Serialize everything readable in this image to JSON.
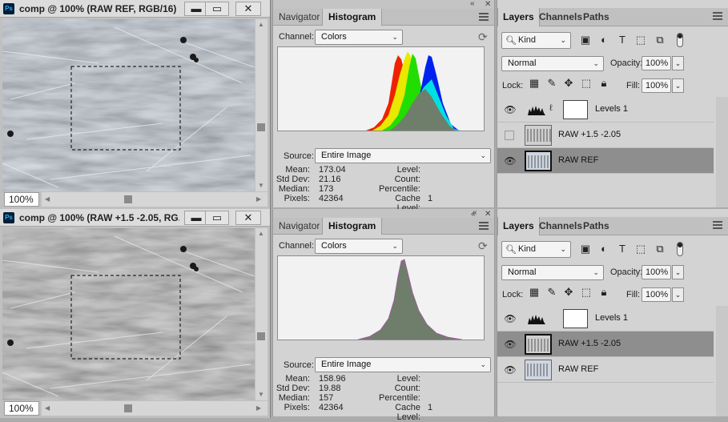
{
  "docs": [
    {
      "title": "comp @ 100% (RAW REF, RGB/16) *",
      "zoom": "100%",
      "minimize_label": "▬",
      "restore_label": "▭",
      "close_label": "✕"
    },
    {
      "title": "comp @ 100% (RAW +1.5 -2.05, RG...",
      "zoom": "100%",
      "minimize_label": "▬",
      "restore_label": "▭",
      "close_label": "✕"
    }
  ],
  "histograms": [
    {
      "tabs": [
        "Navigator",
        "Histogram"
      ],
      "channel_label": "Channel:",
      "channel_value": "Colors",
      "source_label": "Source:",
      "source_value": "Entire Image",
      "stats_left": [
        {
          "label": "Mean:",
          "value": "173.04"
        },
        {
          "label": "Std Dev:",
          "value": "21.16"
        },
        {
          "label": "Median:",
          "value": "173"
        },
        {
          "label": "Pixels:",
          "value": "42364"
        }
      ],
      "stats_right": [
        {
          "label": "Level:",
          "value": ""
        },
        {
          "label": "Count:",
          "value": ""
        },
        {
          "label": "Percentile:",
          "value": ""
        },
        {
          "label": "Cache Level:",
          "value": "1"
        }
      ]
    },
    {
      "tabs": [
        "Navigator",
        "Histogram"
      ],
      "channel_label": "Channel:",
      "channel_value": "Colors",
      "source_label": "Source:",
      "source_value": "Entire Image",
      "stats_left": [
        {
          "label": "Mean:",
          "value": "158.96"
        },
        {
          "label": "Std Dev:",
          "value": "19.88"
        },
        {
          "label": "Median:",
          "value": "157"
        },
        {
          "label": "Pixels:",
          "value": "42364"
        }
      ],
      "stats_right": [
        {
          "label": "Level:",
          "value": ""
        },
        {
          "label": "Count:",
          "value": ""
        },
        {
          "label": "Percentile:",
          "value": ""
        },
        {
          "label": "Cache Level:",
          "value": "1"
        }
      ]
    }
  ],
  "layers_panels": [
    {
      "tabs": [
        "Layers",
        "Channels",
        "Paths"
      ],
      "kind_label": "Kind",
      "blend_mode": "Normal",
      "opacity_label": "Opacity:",
      "opacity_value": "100%",
      "lock_label": "Lock:",
      "fill_label": "Fill:",
      "fill_value": "100%",
      "layers": [
        {
          "name": "Levels 1",
          "type": "adjustment",
          "visible": true,
          "selected": false
        },
        {
          "name": "RAW +1.5 -2.05",
          "type": "pixel",
          "visible": false,
          "selected": false
        },
        {
          "name": "RAW REF",
          "type": "pixel",
          "visible": true,
          "selected": true
        }
      ]
    },
    {
      "tabs": [
        "Layers",
        "Channels",
        "Paths"
      ],
      "kind_label": "Kind",
      "blend_mode": "Normal",
      "opacity_label": "Opacity:",
      "opacity_value": "100%",
      "lock_label": "Lock:",
      "fill_label": "Fill:",
      "fill_value": "100%",
      "layers": [
        {
          "name": "Levels 1",
          "type": "adjustment",
          "visible": true,
          "selected": false
        },
        {
          "name": "RAW +1.5 -2.05",
          "type": "pixel",
          "visible": true,
          "selected": true
        },
        {
          "name": "RAW REF",
          "type": "pixel",
          "visible": true,
          "selected": false
        }
      ]
    }
  ],
  "icons": {
    "eye": "eye-icon",
    "search": "search-icon",
    "refresh": "refresh-icon",
    "panel_menu": "panel-menu-icon",
    "collapse": "collapse-icon",
    "close_panel": "close-panel-icon"
  },
  "colors": {
    "selected_layer": "#8e8e8e",
    "histogram_bg": "#f2f2f2",
    "red_channel": "#ee2200",
    "yellow": "#e8e800",
    "green_channel": "#22dd00",
    "cyan": "#00e0e0",
    "blue_channel": "#0022ee",
    "luminosity": "#6e7e6a"
  }
}
